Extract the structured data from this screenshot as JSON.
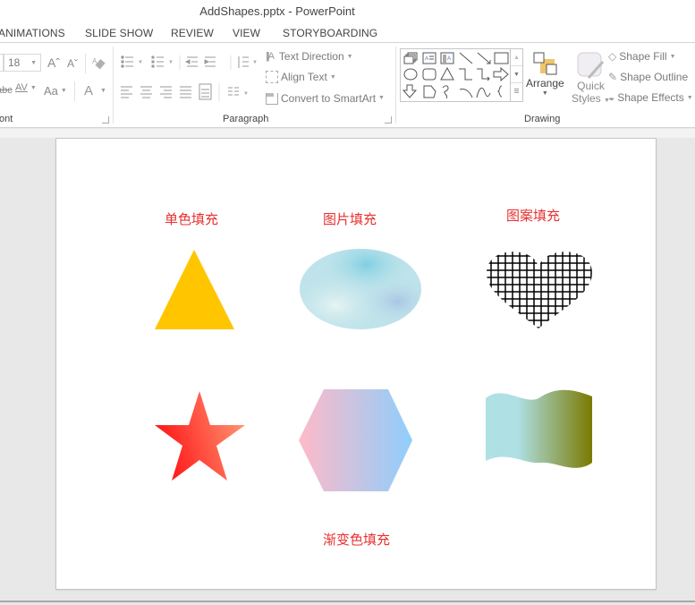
{
  "window": {
    "title": "AddShapes.pptx - PowerPoint"
  },
  "tabs": [
    {
      "label": "ANIMATIONS"
    },
    {
      "label": "SLIDE SHOW"
    },
    {
      "label": "REVIEW"
    },
    {
      "label": "VIEW"
    },
    {
      "label": "STORYBOARDING"
    }
  ],
  "ribbon": {
    "font_group": {
      "label": "ont",
      "font_size": "18",
      "grow_font_icon": "Aˆ",
      "shrink_font_icon": "Aˇ",
      "clear_format_icon": "eraser",
      "strike_text": "abc",
      "char_spacing_text": "AV",
      "change_case_text": "Aa",
      "font_color_text": "A"
    },
    "paragraph_group": {
      "label": "Paragraph",
      "text_direction": "Text Direction",
      "align_text": "Align Text",
      "convert_smartart": "Convert to SmartArt"
    },
    "drawing_group": {
      "label": "Drawing",
      "arrange": "Arrange",
      "quick_styles_line1": "Quick",
      "quick_styles_line2": "Styles",
      "shape_fill": "Shape Fill",
      "shape_outline": "Shape Outline",
      "shape_effects": "Shape Effects",
      "arrange_colors": {
        "accent": "#f0c46a",
        "outline": "#555555"
      }
    }
  },
  "slide": {
    "labels": {
      "solid_fill": "单色填充",
      "picture_fill": "图片填充",
      "pattern_fill": "图案填充",
      "gradient_fill": "渐变色填充"
    },
    "label_color": "#e8312f",
    "shapes": {
      "triangle": {
        "type": "triangle",
        "fill": "#ffc600"
      },
      "ellipse": {
        "type": "ellipse",
        "fill": "picture",
        "tint": "#bfe3ea"
      },
      "heart": {
        "type": "heart",
        "fill": "pattern-grid",
        "pattern_color": "#000000"
      },
      "star": {
        "type": "star",
        "gradient": [
          "#ff1a1a",
          "#ffa27c"
        ]
      },
      "hexagon": {
        "type": "hexagon",
        "gradient": [
          "#ffbac8",
          "#8fcefc"
        ]
      },
      "wave": {
        "type": "wave",
        "gradient": [
          "#aee0e4",
          "#aee0e4",
          "#7a7a00"
        ]
      }
    }
  }
}
